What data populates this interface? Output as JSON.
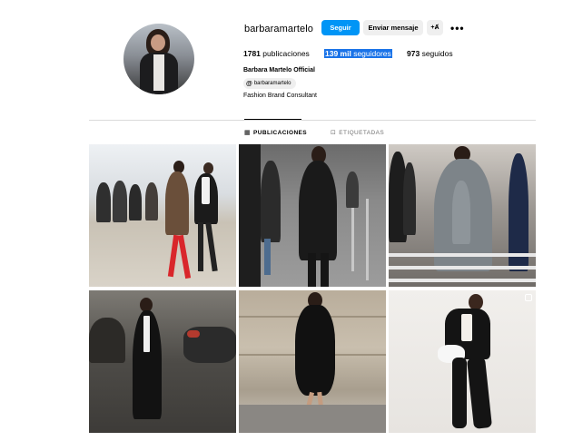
{
  "profile": {
    "username": "barbaramartelo",
    "follow_label": "Seguir",
    "message_label": "Enviar mensaje",
    "suggest_icon": "+Ⱥ",
    "more_label": "•••",
    "posts_count": "1781",
    "posts_label": "publicaciones",
    "followers_count": "139 mil",
    "followers_label": "seguidores",
    "following_count": "973",
    "following_label": "seguidos",
    "full_name": "Barbara Martelo Official",
    "threads_handle": "barbaramartelo",
    "bio": "Fashion Brand Consultant"
  },
  "tabs": [
    {
      "label": "PUBLICACIONES",
      "icon": "grid-icon",
      "active": true
    },
    {
      "label": "ETIQUETADAS",
      "icon": "tag-icon",
      "active": false
    }
  ],
  "colors": {
    "accent": "#0095f6",
    "selection": "#1a73e8",
    "secondary_button": "#efefef",
    "divider": "#dbdbdb"
  }
}
